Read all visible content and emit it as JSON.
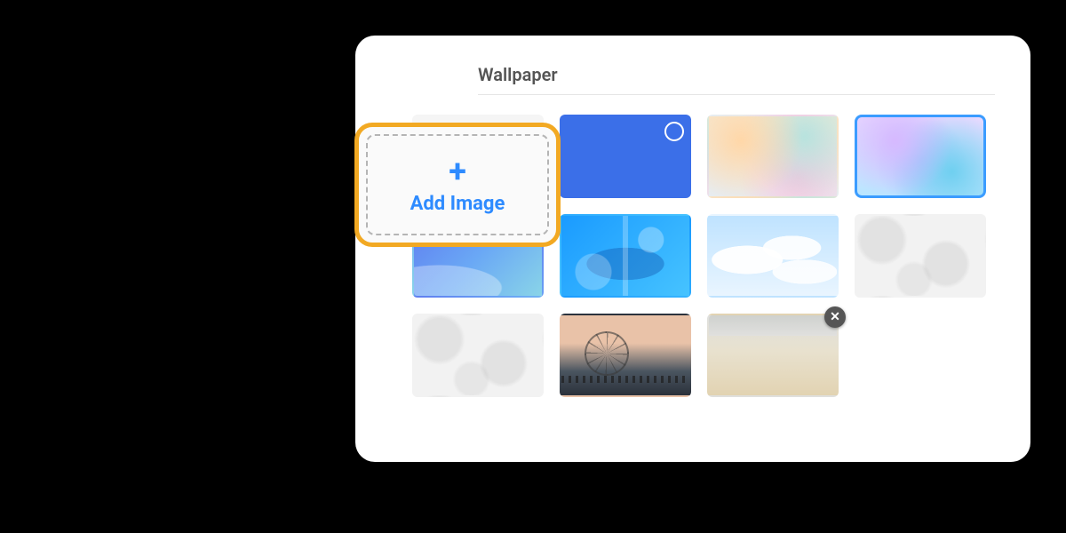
{
  "section": {
    "title": "Wallpaper"
  },
  "addImage": {
    "plus_glyph": "+",
    "label": "Add Image"
  },
  "close_glyph": "✕",
  "wallpapers": [
    {
      "id": "solid-blue",
      "selection_ring": true
    },
    {
      "id": "pastel-gradient"
    },
    {
      "id": "holo-gradient",
      "selected": true
    },
    {
      "id": "blue-waves"
    },
    {
      "id": "tech-blue"
    },
    {
      "id": "clouds"
    },
    {
      "id": "marble-1"
    },
    {
      "id": "marble-2"
    },
    {
      "id": "sunset-wheel"
    },
    {
      "id": "beach",
      "deletable": true
    }
  ],
  "colors": {
    "highlight_border": "#f2a923",
    "accent": "#2e8bff",
    "selected_border": "#3b9cff"
  }
}
